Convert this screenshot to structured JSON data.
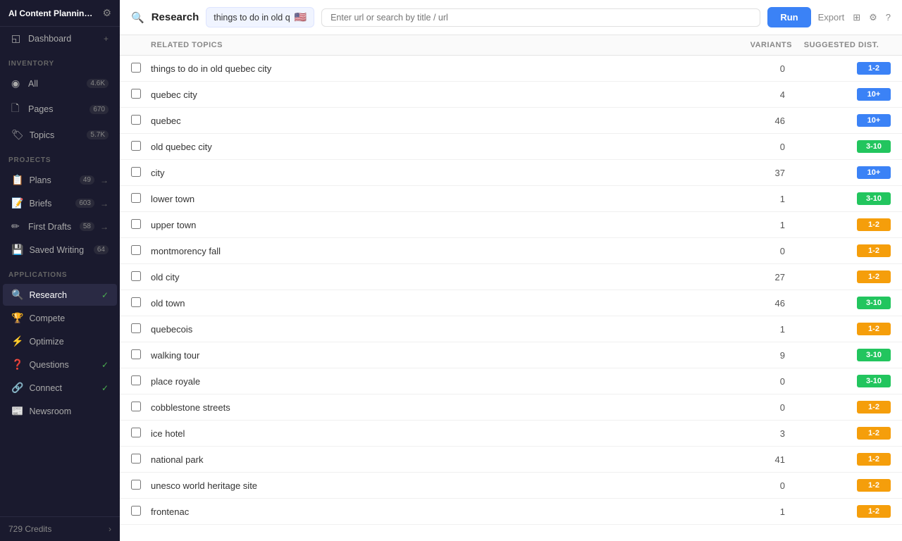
{
  "sidebar": {
    "app_title": "AI Content Planning and ...",
    "gear_icon": "⚙",
    "sections": {
      "inventory_label": "INVENTORY",
      "projects_label": "PROJECTS",
      "applications_label": "APPLICATIONS"
    },
    "inventory_items": [
      {
        "id": "all",
        "icon": "◉",
        "label": "All",
        "badge": "4.6K",
        "arrow": ""
      },
      {
        "id": "pages",
        "icon": "📄",
        "label": "Pages",
        "badge": "670",
        "arrow": ""
      },
      {
        "id": "topics",
        "icon": "🏷",
        "label": "Topics",
        "badge": "5.7K",
        "arrow": ""
      }
    ],
    "project_items": [
      {
        "id": "plans",
        "icon": "📋",
        "label": "Plans",
        "badge": "49",
        "arrow": "→"
      },
      {
        "id": "briefs",
        "icon": "📝",
        "label": "Briefs",
        "badge": "603",
        "arrow": "→"
      },
      {
        "id": "firstdrafts",
        "icon": "✏",
        "label": "First Drafts",
        "badge": "58",
        "arrow": "→"
      },
      {
        "id": "savedwriting",
        "icon": "💾",
        "label": "Saved Writing",
        "badge": "64",
        "arrow": ""
      }
    ],
    "app_items": [
      {
        "id": "research",
        "icon": "🔍",
        "label": "Research",
        "check": "✓",
        "active": true
      },
      {
        "id": "compete",
        "icon": "🏆",
        "label": "Compete",
        "check": ""
      },
      {
        "id": "optimize",
        "icon": "⚡",
        "label": "Optimize",
        "check": ""
      },
      {
        "id": "questions",
        "icon": "❓",
        "label": "Questions",
        "check": "✓"
      },
      {
        "id": "connect",
        "icon": "🔗",
        "label": "Connect",
        "check": "✓"
      },
      {
        "id": "newsroom",
        "icon": "📰",
        "label": "Newsroom",
        "check": ""
      }
    ],
    "dashboard": {
      "label": "Dashboard",
      "icon": "◱"
    },
    "footer": {
      "credits": "729 Credits",
      "arrow": "›"
    }
  },
  "topbar": {
    "search_icon": "🔍",
    "title": "Research",
    "query_text": "things to do in old q",
    "flag": "🇺🇸",
    "url_placeholder": "Enter url or search by title / url",
    "run_label": "Run",
    "export_label": "Export"
  },
  "table": {
    "col_topic": "RELATED TOPICS",
    "col_variants": "VARIANTS",
    "col_suggested": "SUGGESTED DIST.",
    "rows": [
      {
        "label": "things to do in old quebec city",
        "variants": "0",
        "dist": "1-2",
        "dist_type": "blue"
      },
      {
        "label": "quebec city",
        "variants": "4",
        "dist": "10+",
        "dist_type": "blue"
      },
      {
        "label": "quebec",
        "variants": "46",
        "dist": "10+",
        "dist_type": "blue"
      },
      {
        "label": "old quebec city",
        "variants": "0",
        "dist": "3-10",
        "dist_type": "green"
      },
      {
        "label": "city",
        "variants": "37",
        "dist": "10+",
        "dist_type": "blue"
      },
      {
        "label": "lower town",
        "variants": "1",
        "dist": "3-10",
        "dist_type": "green"
      },
      {
        "label": "upper town",
        "variants": "1",
        "dist": "1-2",
        "dist_type": "yellow"
      },
      {
        "label": "montmorency fall",
        "variants": "0",
        "dist": "1-2",
        "dist_type": "yellow"
      },
      {
        "label": "old city",
        "variants": "27",
        "dist": "1-2",
        "dist_type": "yellow"
      },
      {
        "label": "old town",
        "variants": "46",
        "dist": "3-10",
        "dist_type": "green"
      },
      {
        "label": "quebecois",
        "variants": "1",
        "dist": "1-2",
        "dist_type": "yellow"
      },
      {
        "label": "walking tour",
        "variants": "9",
        "dist": "3-10",
        "dist_type": "green"
      },
      {
        "label": "place royale",
        "variants": "0",
        "dist": "3-10",
        "dist_type": "green"
      },
      {
        "label": "cobblestone streets",
        "variants": "0",
        "dist": "1-2",
        "dist_type": "yellow"
      },
      {
        "label": "ice hotel",
        "variants": "3",
        "dist": "1-2",
        "dist_type": "yellow"
      },
      {
        "label": "national park",
        "variants": "41",
        "dist": "1-2",
        "dist_type": "yellow"
      },
      {
        "label": "unesco world heritage site",
        "variants": "0",
        "dist": "1-2",
        "dist_type": "yellow"
      },
      {
        "label": "frontenac",
        "variants": "1",
        "dist": "1-2",
        "dist_type": "yellow"
      }
    ]
  }
}
